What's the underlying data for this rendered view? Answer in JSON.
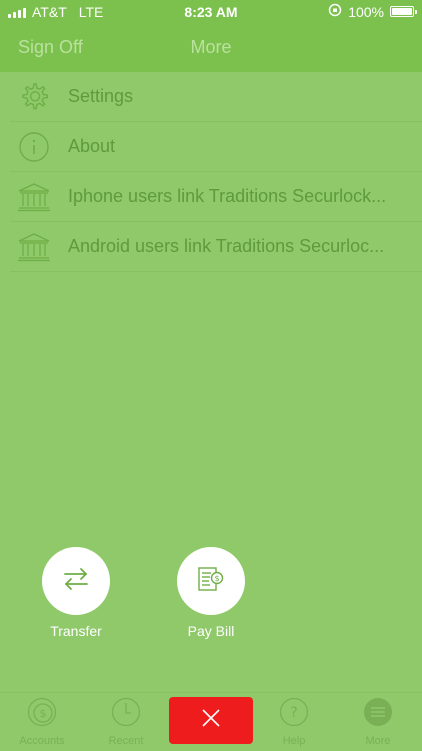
{
  "status_bar": {
    "carrier": "AT&T",
    "network": "LTE",
    "time": "8:23 AM",
    "battery": "100%",
    "battery_level": 1.0
  },
  "nav": {
    "left_button": "Sign Off",
    "title": "More"
  },
  "menu": {
    "items": [
      {
        "label": "Settings",
        "icon": "gear-icon"
      },
      {
        "label": "About",
        "icon": "info-icon"
      },
      {
        "label": "Iphone users link Traditions Securlock...",
        "icon": "bank-icon"
      },
      {
        "label": "Android users link Traditions Securloc...",
        "icon": "bank-icon"
      }
    ]
  },
  "quick_actions": [
    {
      "label": "Transfer",
      "icon": "transfer-arrows-icon"
    },
    {
      "label": "Pay Bill",
      "icon": "bill-icon"
    }
  ],
  "tabs": [
    {
      "label": "Accounts",
      "icon": "money-icon"
    },
    {
      "label": "Recent",
      "icon": "clock-icon"
    },
    {
      "label": "Help",
      "icon": "help-icon"
    },
    {
      "label": "More",
      "icon": "menu-icon"
    }
  ],
  "colors": {
    "background": "#8fc96a",
    "header": "#7cc04e",
    "close_button": "#ee1c1c",
    "icon_green": "#6fae47"
  }
}
